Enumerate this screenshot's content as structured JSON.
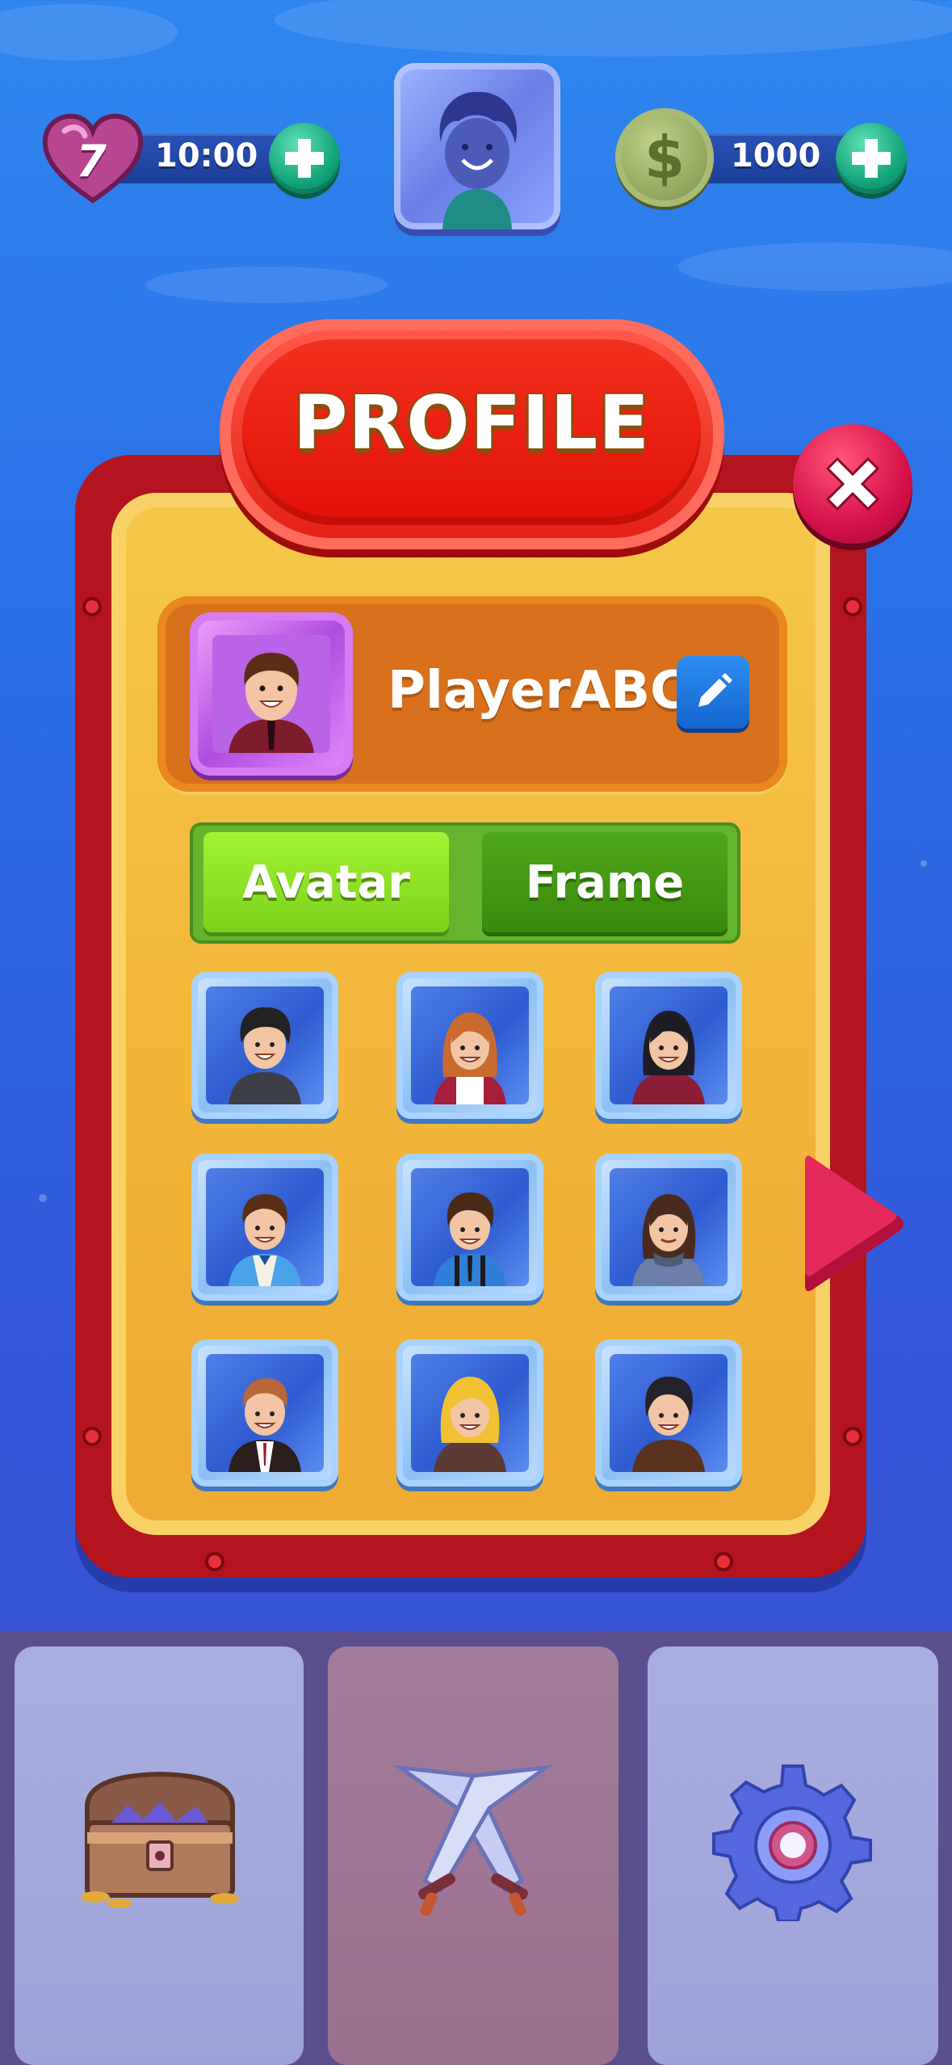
{
  "hud": {
    "lives": "7",
    "timer": "10:00",
    "coins": "1000",
    "coin_symbol": "$"
  },
  "panel": {
    "title": "PROFILE",
    "player_name": "PlayerABC"
  },
  "tabs": [
    {
      "label": "Avatar",
      "selected": true
    },
    {
      "label": "Frame",
      "selected": false
    }
  ],
  "avatars": [
    {
      "icon": "avatar-curly-hair-boy-icon"
    },
    {
      "icon": "avatar-ginger-girl-icon"
    },
    {
      "icon": "avatar-dark-hair-girl-icon"
    },
    {
      "icon": "avatar-vest-boy-icon"
    },
    {
      "icon": "avatar-suspenders-boy-icon"
    },
    {
      "icon": "avatar-scarf-girl-icon"
    },
    {
      "icon": "avatar-suit-man-icon"
    },
    {
      "icon": "avatar-blonde-girl-icon"
    },
    {
      "icon": "avatar-dark-hair-boy-icon"
    }
  ],
  "bottom_nav": [
    {
      "icon": "treasure-chest-icon",
      "active": false
    },
    {
      "icon": "crossed-swords-icon",
      "active": true
    },
    {
      "icon": "gear-icon",
      "active": false
    }
  ],
  "colors": {
    "background": "#2a6fe6",
    "panel_frame": "#b4141e",
    "panel_fill": "#f2b63a",
    "title_banner": "#e41e14",
    "tab_selected": "#7bd21a",
    "tab_unselected": "#3a8a0c",
    "plus_button": "#12a37a",
    "close_button": "#d6104a"
  }
}
